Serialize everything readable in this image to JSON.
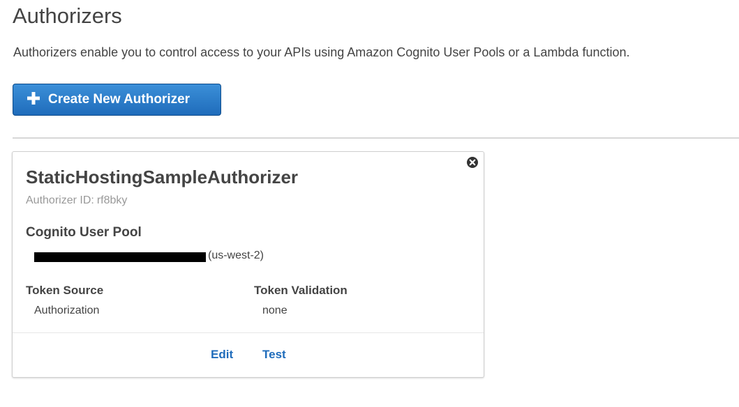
{
  "page": {
    "title": "Authorizers",
    "description": "Authorizers enable you to control access to your APIs using Amazon Cognito User Pools or a Lambda function."
  },
  "create_button": {
    "label": "Create New Authorizer",
    "icon": "plus-icon"
  },
  "authorizer": {
    "name": "StaticHostingSampleAuthorizer",
    "id_label": "Authorizer ID:",
    "id_value": "rf8bky",
    "type": "Cognito User Pool",
    "user_pool_region": "(us-west-2)",
    "token_source_label": "Token Source",
    "token_source_value": "Authorization",
    "token_validation_label": "Token Validation",
    "token_validation_value": "none",
    "edit_label": "Edit",
    "test_label": "Test",
    "close_icon": "close-icon"
  },
  "colors": {
    "button_primary": "#1f6cbb",
    "link": "#1f6cbb",
    "muted_text": "#999999"
  }
}
